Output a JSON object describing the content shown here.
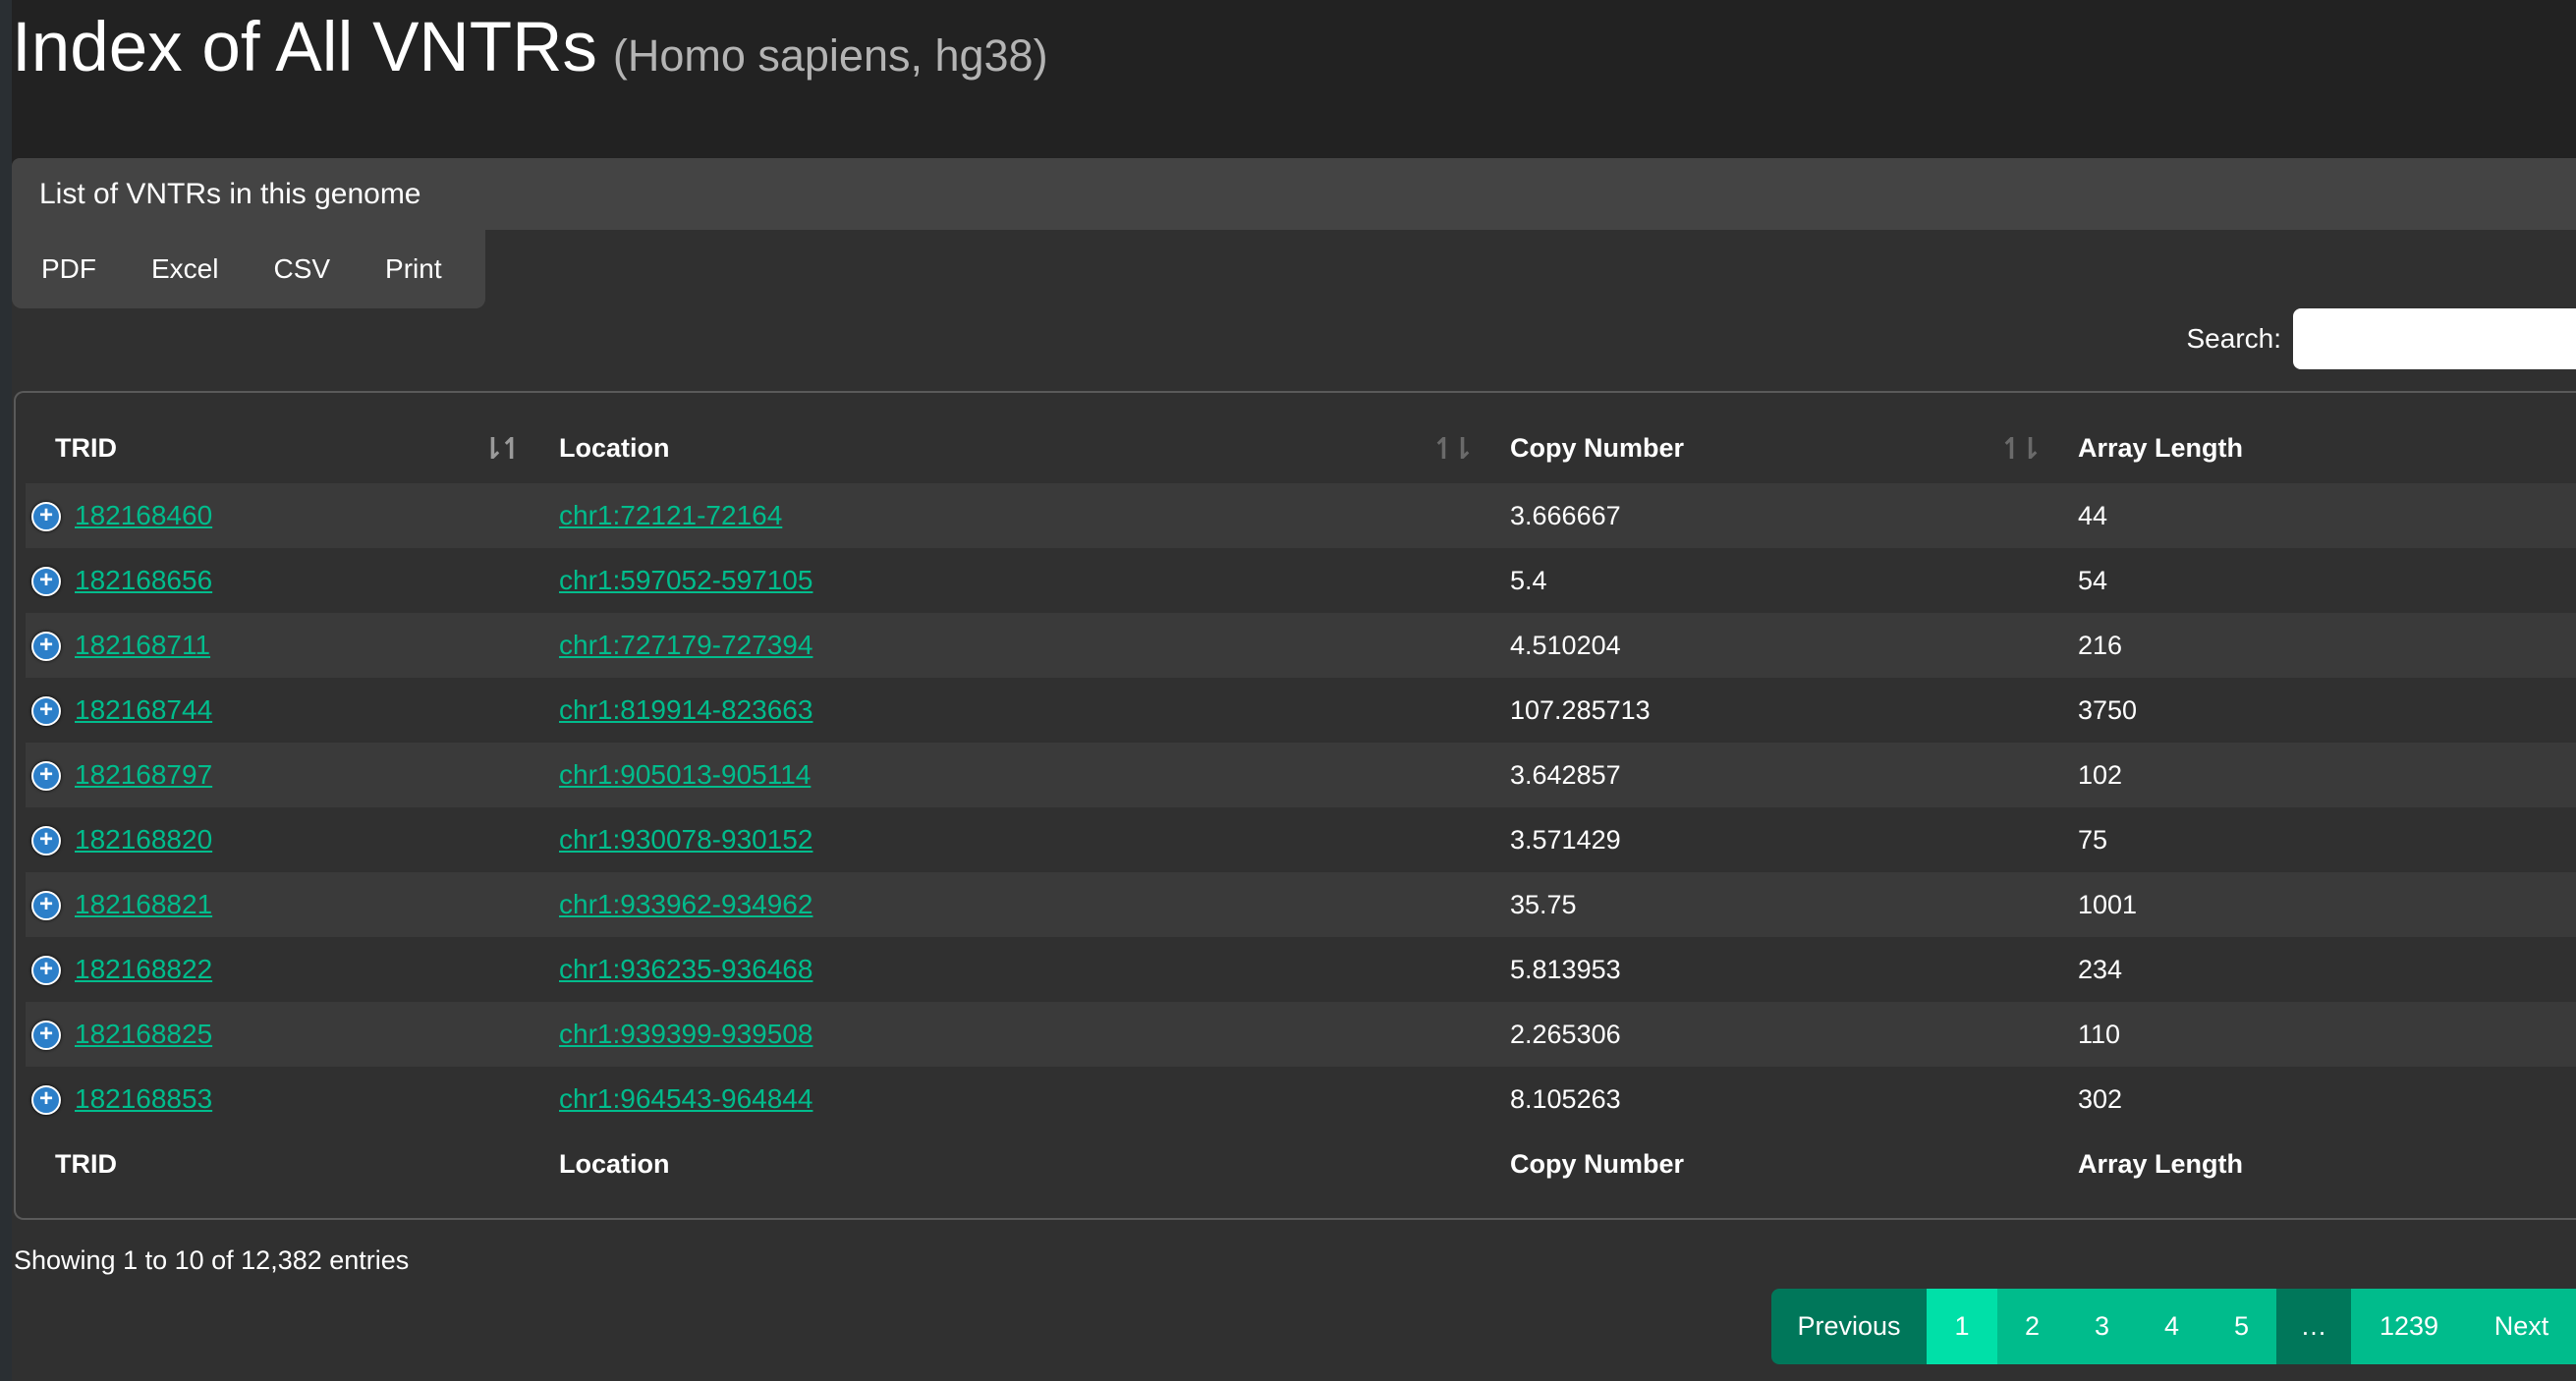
{
  "header": {
    "title": "Index of All VNTRs",
    "subtitle": "(Homo sapiens, hg38)"
  },
  "panel": {
    "heading": "List of VNTRs in this genome"
  },
  "toolbar": {
    "buttons": [
      "PDF",
      "Excel",
      "CSV",
      "Print"
    ]
  },
  "search": {
    "label": "Search:",
    "value": "",
    "placeholder": ""
  },
  "table": {
    "columns": [
      "TRID",
      "Location",
      "Copy Number",
      "Array Length"
    ],
    "sort": {
      "active_column": "TRID",
      "direction": "ascending"
    },
    "rows": [
      {
        "trid": "182168460",
        "location": "chr1:72121-72164",
        "copy_number": "3.666667",
        "array_length": "44"
      },
      {
        "trid": "182168656",
        "location": "chr1:597052-597105",
        "copy_number": "5.4",
        "array_length": "54"
      },
      {
        "trid": "182168711",
        "location": "chr1:727179-727394",
        "copy_number": "4.510204",
        "array_length": "216"
      },
      {
        "trid": "182168744",
        "location": "chr1:819914-823663",
        "copy_number": "107.285713",
        "array_length": "3750"
      },
      {
        "trid": "182168797",
        "location": "chr1:905013-905114",
        "copy_number": "3.642857",
        "array_length": "102"
      },
      {
        "trid": "182168820",
        "location": "chr1:930078-930152",
        "copy_number": "3.571429",
        "array_length": "75"
      },
      {
        "trid": "182168821",
        "location": "chr1:933962-934962",
        "copy_number": "35.75",
        "array_length": "1001"
      },
      {
        "trid": "182168822",
        "location": "chr1:936235-936468",
        "copy_number": "5.813953",
        "array_length": "234"
      },
      {
        "trid": "182168825",
        "location": "chr1:939399-939508",
        "copy_number": "2.265306",
        "array_length": "110"
      },
      {
        "trid": "182168853",
        "location": "chr1:964543-964844",
        "copy_number": "8.105263",
        "array_length": "302"
      }
    ]
  },
  "footer": {
    "showing": "Showing 1 to 10 of 12,382 entries"
  },
  "pagination": {
    "previous": "Previous",
    "pages": [
      "1",
      "2",
      "3",
      "4",
      "5"
    ],
    "current": "1",
    "ellipsis": "…",
    "last": "1239",
    "next": "Next"
  },
  "colors": {
    "background": "#222222",
    "panel": "#303030",
    "row_stripe": "#3a3a3a",
    "link": "#00bc8c",
    "pagination": "#00bc8c",
    "pagination_active": "#00e0a8",
    "pagination_dark": "#00775a"
  }
}
